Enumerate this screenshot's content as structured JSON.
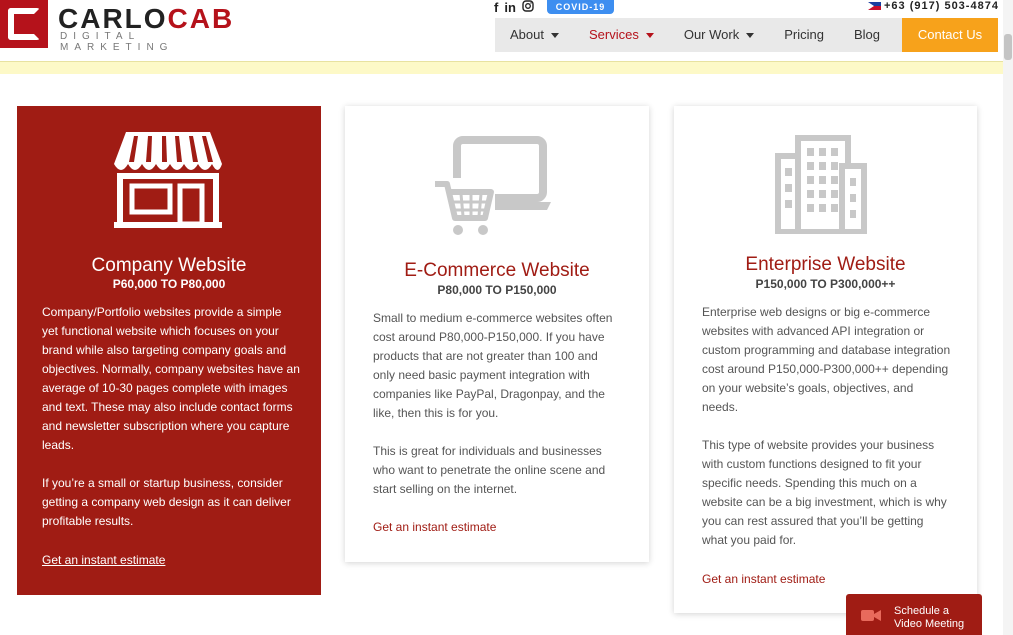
{
  "header": {
    "brand": {
      "name_part1": "CARLO",
      "name_part2": "CAB",
      "tagline": "DIGITAL MARKETING"
    },
    "social": [
      "f",
      "in",
      "ig"
    ],
    "covid_badge": "COVID-19",
    "phone": "+63 (917) 503-4874",
    "nav": {
      "items": [
        {
          "label": "About"
        },
        {
          "label": "Services"
        },
        {
          "label": "Our Work"
        },
        {
          "label": "Pricing"
        },
        {
          "label": "Blog"
        }
      ],
      "contact": "Contact Us"
    }
  },
  "cards": [
    {
      "title": "Company Website",
      "price": "P60,000 TO P80,000",
      "desc1": "Company/Portfolio websites provide a simple yet functional website which focuses on your brand while also targeting company goals and objectives. Normally, company websites have an average of 10-30 pages complete with images and text. These may also include contact forms and newsletter subscription where you capture leads.",
      "desc2": "If you’re a small or startup business, consider getting a company web design as it can deliver profitable results.",
      "link": "Get an instant estimate",
      "icon": "storefront-icon"
    },
    {
      "title": "E-Commerce Website",
      "price": "P80,000 TO P150,000",
      "desc1": "Small to medium e-commerce websites often cost around P80,000-P150,000. If you have products that are not greater than 100 and only need basic payment integration with companies like PayPal, Dragonpay, and the like, then this is for you.",
      "desc2": "This is great for individuals and businesses who want to penetrate the online scene and start selling on the internet.",
      "link": "Get an instant estimate",
      "icon": "ecommerce-cart-icon"
    },
    {
      "title": "Enterprise Website",
      "price": "P150,000 TO P300,000++",
      "desc1": "Enterprise web designs or big e-commerce websites with advanced API integration or custom programming and database integration cost around P150,000-P300,000++ depending on your website’s goals, objectives, and needs.",
      "desc2": "This type of website provides your business with custom functions designed to fit your specific needs. Spending this much on a website can be a big investment, which is why you can rest assured that you’ll be getting what you paid for.",
      "link": "Get an instant estimate",
      "icon": "office-building-icon"
    }
  ],
  "video_meeting": {
    "line1": "Schedule a",
    "line2": "Video Meeting"
  },
  "colors": {
    "brand_red": "#a01c14",
    "nav_bg": "#e9e9e9",
    "contact_orange": "#f7a21b",
    "covid_blue": "#3d8ef0",
    "icon_gray": "#c8c8c8"
  }
}
